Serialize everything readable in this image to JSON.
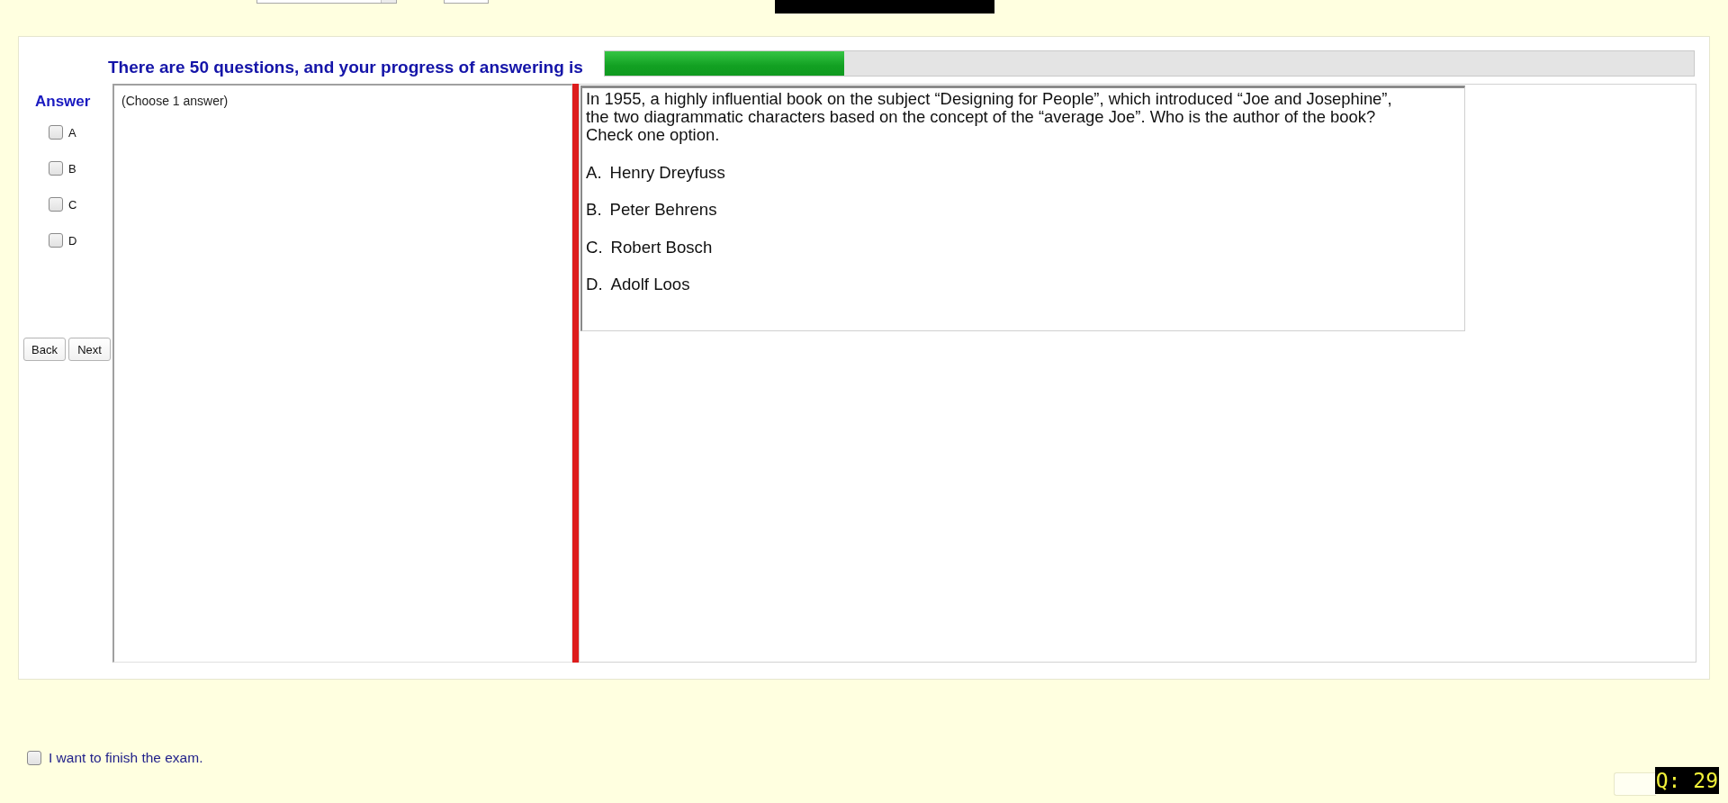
{
  "progress": {
    "label": "There are 50 questions, and your progress of answering is",
    "level": 0.22
  },
  "answer_panel": {
    "title": "Answer",
    "options": [
      {
        "label": "A",
        "checked": false
      },
      {
        "label": "B",
        "checked": false
      },
      {
        "label": "C",
        "checked": false
      },
      {
        "label": "D",
        "checked": false
      }
    ],
    "buttons": [
      "Back",
      "Next"
    ]
  },
  "instruction": "(Choose 1 answer)",
  "question": {
    "stem": [
      "In 1955, a highly influential book on the subject “Designing for People”, which introduced “Joe and Josephine”,",
      "the two diagrammatic characters based on the concept of the “average Joe”. Who is the author of the book?",
      "Check one option."
    ],
    "options": [
      {
        "letter": "A.",
        "answer": "Henry Dreyfuss"
      },
      {
        "letter": "B.",
        "answer": "Peter Behrens"
      },
      {
        "letter": "C.",
        "answer": "Robert Bosch"
      },
      {
        "letter": "D.",
        "answer": "Adolf Loos"
      }
    ]
  },
  "finish": {
    "label": "I want to finish the exam.",
    "checked": false
  },
  "footer_button": {
    "disabled": true
  },
  "question_badge": "Q: 29"
}
